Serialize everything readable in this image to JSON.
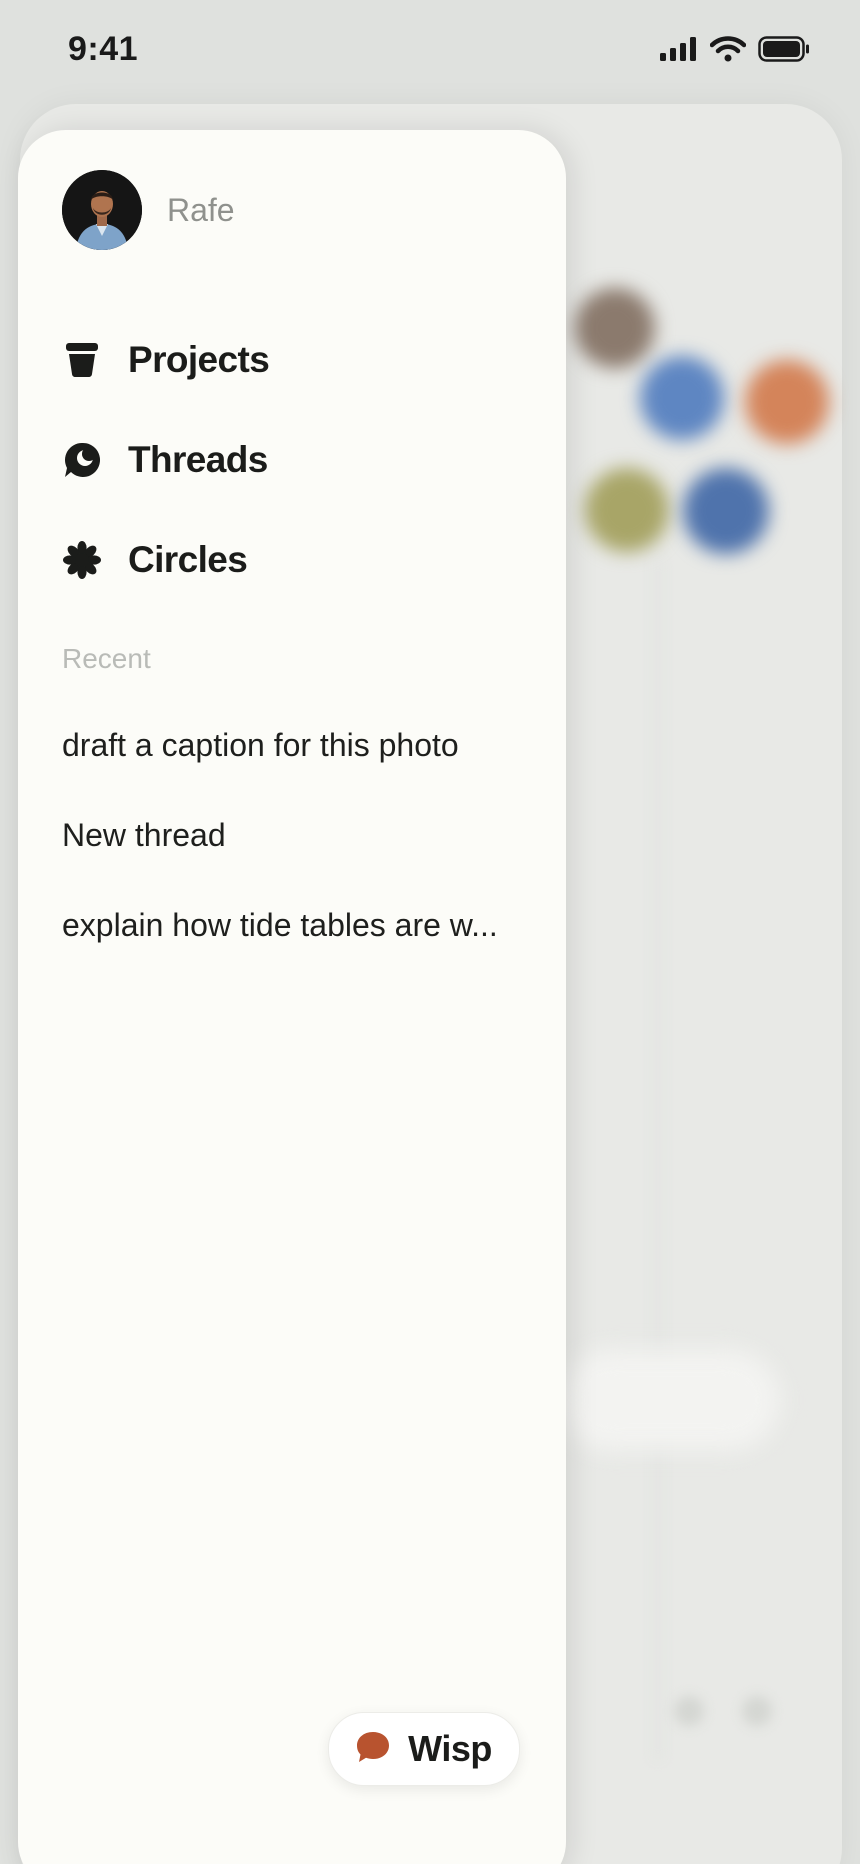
{
  "status_bar": {
    "time": "9:41"
  },
  "drawer": {
    "profile": {
      "name": "Rafe"
    },
    "nav": [
      {
        "label": "Projects",
        "icon": "cup-icon"
      },
      {
        "label": "Threads",
        "icon": "moon-chat-icon"
      },
      {
        "label": "Circles",
        "icon": "asterisk-icon"
      }
    ],
    "recent": {
      "heading": "Recent",
      "items": [
        "draft a caption for this photo",
        "New thread",
        "explain how tide tables are w..."
      ]
    },
    "wisp_button": {
      "label": "Wisp",
      "icon": "speech-bubble-icon",
      "icon_color": "#b8532f"
    }
  },
  "colors": {
    "drawer_background": "#fcfcf8",
    "screen_background": "#dfe1de",
    "accent": "#b8532f"
  }
}
